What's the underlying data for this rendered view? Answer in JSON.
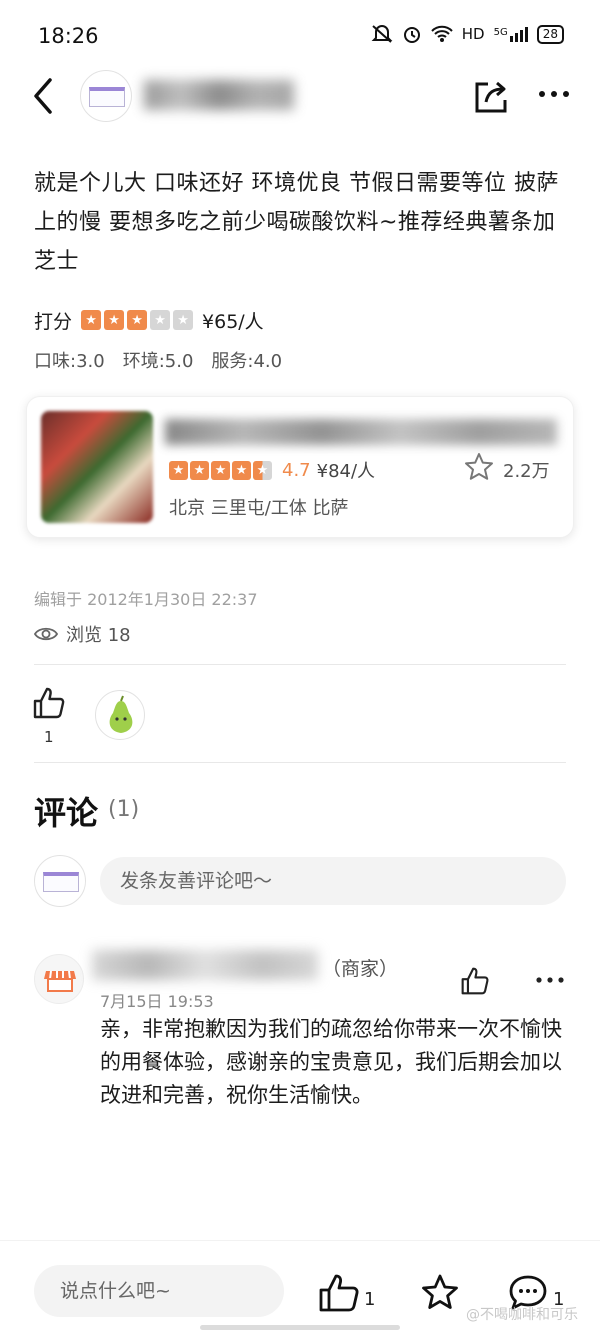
{
  "status_bar": {
    "time": "18:26",
    "network": "HD",
    "signal": "5G",
    "battery": "28"
  },
  "header": {
    "back_icon": "back-arrow-icon",
    "share_icon": "share-icon",
    "more_icon": "more-icon"
  },
  "review": {
    "text": "就是个儿大 口味还好 环境优良 节假日需要等位 披萨上的慢 要想多吃之前少喝碳酸饮料~推荐经典薯条加芝士",
    "rating_label": "打分",
    "stars": 3,
    "price": "¥65/人",
    "subscores": {
      "taste": "口味:3.0",
      "environment": "环境:5.0",
      "service": "服务:4.0"
    }
  },
  "shop": {
    "stars": 4.5,
    "score": "4.7",
    "price": "¥84/人",
    "favorites": "2.2万",
    "location": "北京 三里屯/工体 比萨"
  },
  "meta": {
    "edited": "编辑于 2012年1月30日 22:37",
    "views": "浏览 18",
    "likes": "1"
  },
  "comments": {
    "title": "评论",
    "count": "(1)",
    "input_placeholder": "发条友善评论吧～",
    "items": [
      {
        "tag": "（商家）",
        "date": "7月15日  19:53",
        "text": "亲，非常抱歉因为我们的疏忽给你带来一次不愉快的用餐体验，感谢亲的宝贵意见，我们后期会加以改进和完善，祝你生活愉快。"
      }
    ]
  },
  "bottom_bar": {
    "placeholder": "说点什么吧~",
    "like_count": "1",
    "comment_count": "1",
    "watermark": "@不喝咖啡和可乐"
  },
  "colors": {
    "accent": "#f08a4b",
    "star_off": "#d6d6d6"
  }
}
